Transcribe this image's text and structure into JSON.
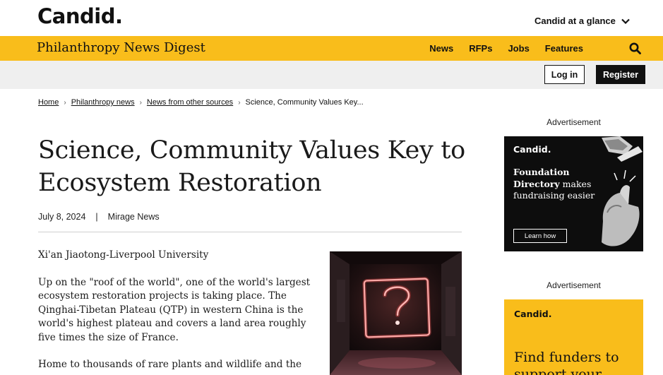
{
  "header": {
    "brand": "Candid.",
    "glance_label": "Candid at a glance"
  },
  "nav": {
    "site_title": "Philanthropy News Digest",
    "links": [
      "News",
      "RFPs",
      "Jobs",
      "Features"
    ]
  },
  "account": {
    "login_label": "Log in",
    "register_label": "Register"
  },
  "breadcrumb": {
    "items": [
      "Home",
      "Philanthropy news",
      "News from other sources"
    ],
    "current": "Science, Community Values Key..."
  },
  "article": {
    "title": "Science, Community Values Key to Ecosystem Restoration",
    "date": "July 8, 2024",
    "meta_sep": "|",
    "source": "Mirage News",
    "paragraphs": [
      "Xi'an Jiaotong-Liverpool University",
      "Up on the \"roof of the world\", one of the world's largest ecosystem restoration projects is taking place. The Qinghai-Tibetan Plateau (QTP) in western China is the world's highest plateau and covers a land area roughly five times the size of France.",
      "Home to thousands of rare plants and wildlife and the"
    ]
  },
  "ads": {
    "label": "Advertisement",
    "ad1": {
      "brand": "Candid.",
      "copy_bold": "Foundation Directory",
      "copy_rest": " makes fundraising easier",
      "button": "Learn how"
    },
    "ad2": {
      "brand": "Candid.",
      "copy": "Find funders to support your"
    }
  },
  "colors": {
    "brand_yellow": "#f9bd1b",
    "account_bar": "#efefef",
    "dark": "#111111"
  }
}
